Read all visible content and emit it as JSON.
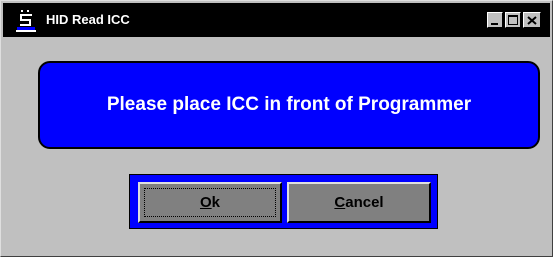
{
  "window": {
    "title": "HID Read ICC",
    "icon": "app-icon",
    "controls": {
      "minimize": "minimize-icon",
      "maximize": "maximize-icon",
      "close": "close-icon"
    }
  },
  "message": {
    "text": "Please place ICC in front of Programmer"
  },
  "buttons": {
    "ok": {
      "mnemonic": "O",
      "rest": "k"
    },
    "cancel": {
      "mnemonic": "C",
      "rest": "ancel"
    }
  },
  "colors": {
    "panel": "#0000ff",
    "face": "#c0c0c0",
    "button": "#808080",
    "titlebar": "#000000"
  }
}
